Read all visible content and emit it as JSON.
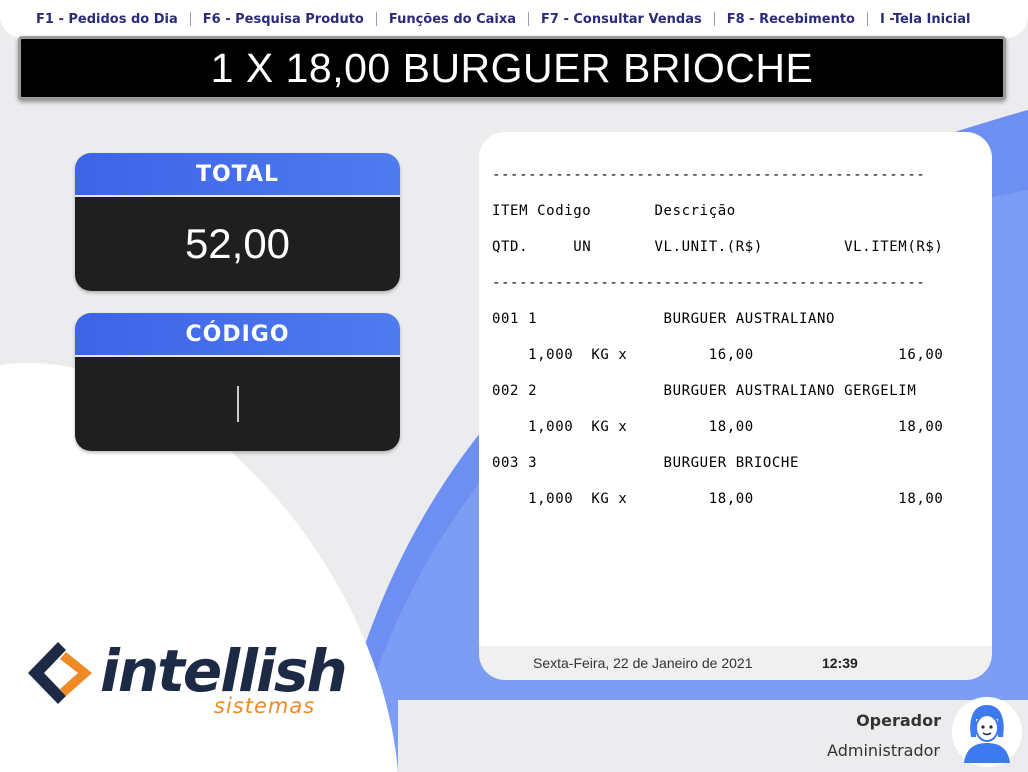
{
  "menu": {
    "items": [
      {
        "label": "F1 - Pedidos do Dia"
      },
      {
        "label": "F6 - Pesquisa Produto"
      },
      {
        "label": "Funções do Caixa"
      },
      {
        "label": "F7 - Consultar Vendas"
      },
      {
        "label": "F8 - Recebimento"
      },
      {
        "label": "I -Tela Inicial"
      }
    ]
  },
  "product_display": "1 X 18,00 BURGUER BRIOCHE",
  "total": {
    "label": "TOTAL",
    "value": "52,00"
  },
  "code": {
    "label": "CÓDIGO",
    "value": ""
  },
  "receipt": {
    "lines": [
      "------------------------------------------------",
      "ITEM Codigo       Descrição",
      "QTD.     UN       VL.UNIT.(R$)         VL.ITEM(R$)",
      "------------------------------------------------",
      "001 1              BURGUER AUSTRALIANO",
      "    1,000  KG x         16,00                16,00",
      "002 2              BURGUER AUSTRALIANO GERGELIM",
      "    1,000  KG x         18,00                18,00",
      "003 3              BURGUER BRIOCHE",
      "    1,000  KG x         18,00                18,00"
    ]
  },
  "status": {
    "date": "Sexta-Feira, 22 de Janeiro de 2021",
    "time": "12:39"
  },
  "logo": {
    "name": "intellish",
    "sub": "sistemas"
  },
  "operator": {
    "label": "Operador",
    "name": "Administrador"
  },
  "colors": {
    "accent": "#4f7af0",
    "brand_dark": "#1c2a46",
    "brand_orange": "#f08a24"
  }
}
